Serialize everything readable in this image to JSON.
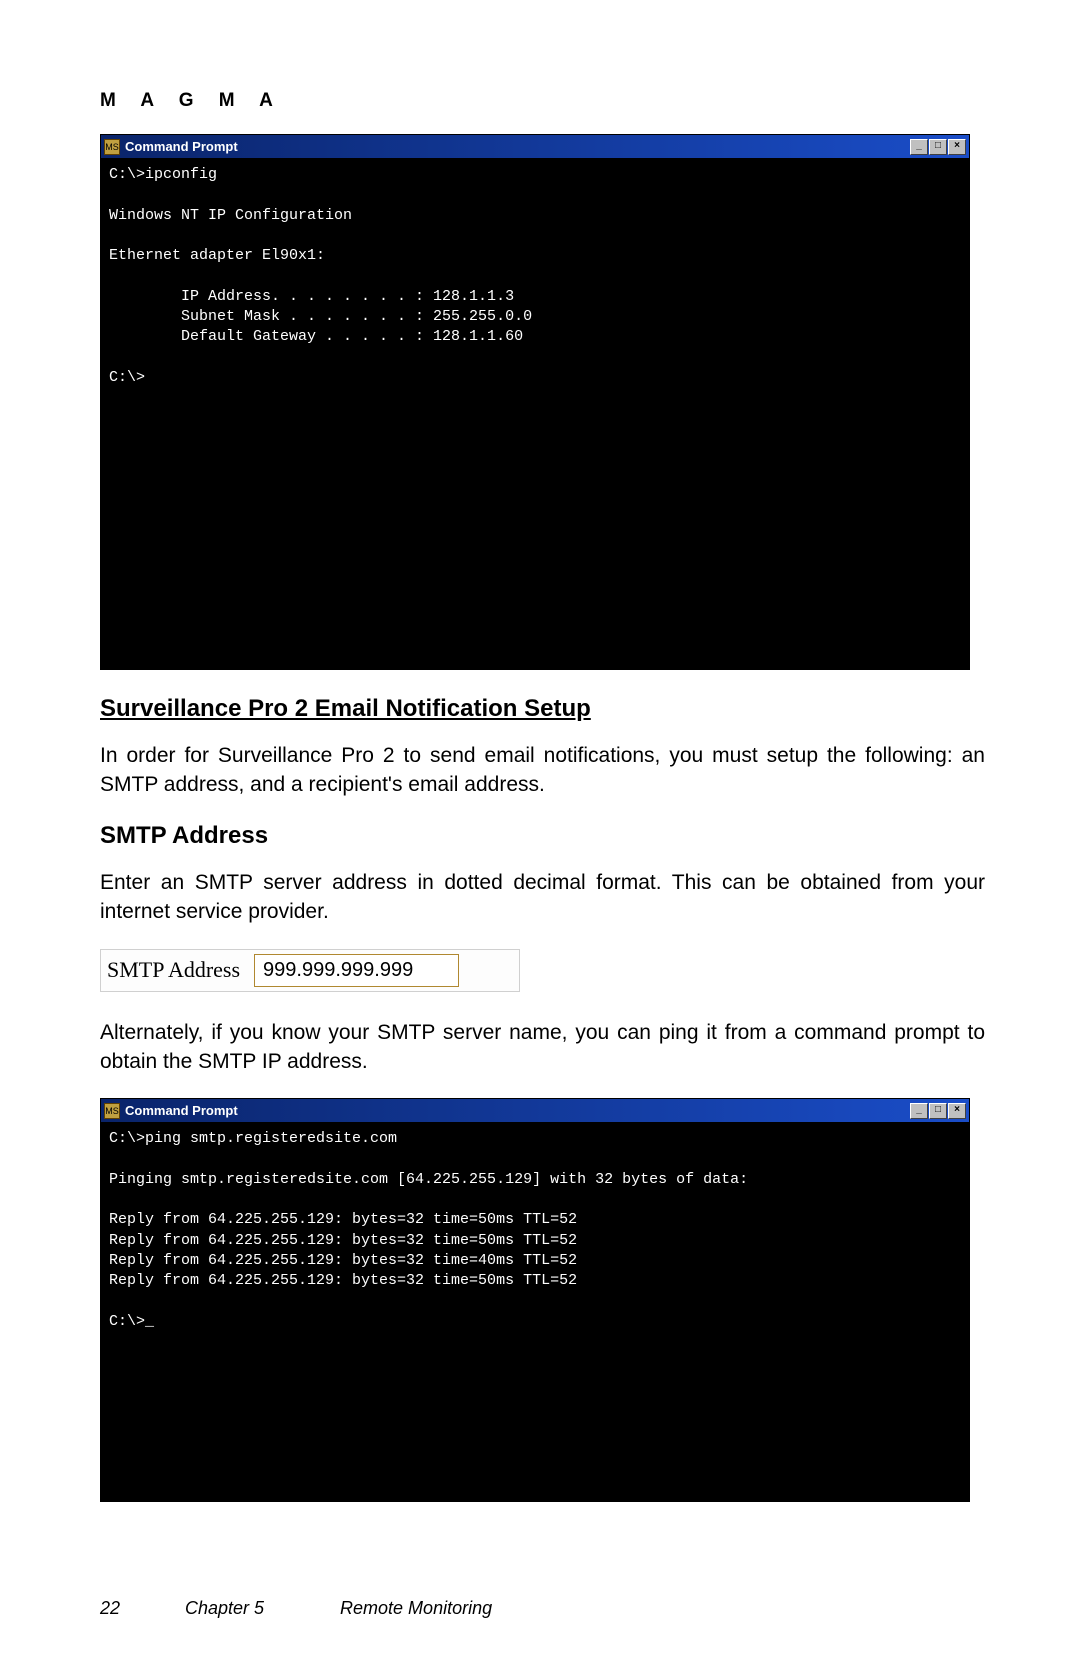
{
  "brand": "M A G M A",
  "cmd1": {
    "title": "Command Prompt",
    "content": "C:\\>ipconfig\n\nWindows NT IP Configuration\n\nEthernet adapter El90x1:\n\n        IP Address. . . . . . . . : 128.1.1.3\n        Subnet Mask . . . . . . . : 255.255.0.0\n        Default Gateway . . . . . : 128.1.1.60\n\nC:\\>"
  },
  "heading1": "Surveillance Pro 2 Email Notification Setup",
  "para1": "In order for Surveillance Pro 2 to send email notifications, you must setup the following: an SMTP address, and a recipient's email address.",
  "heading2": "SMTP Address",
  "para2": "Enter an SMTP server address in dotted decimal format. This can be obtained from your internet service provider.",
  "smtp": {
    "label": "SMTP Address",
    "value": "999.999.999.999"
  },
  "para3": "Alternately, if you know your SMTP server name, you can ping it from a command prompt to obtain the SMTP IP address.",
  "cmd2": {
    "title": "Command Prompt",
    "content": "C:\\>ping smtp.registeredsite.com\n\nPinging smtp.registeredsite.com [64.225.255.129] with 32 bytes of data:\n\nReply from 64.225.255.129: bytes=32 time=50ms TTL=52\nReply from 64.225.255.129: bytes=32 time=50ms TTL=52\nReply from 64.225.255.129: bytes=32 time=40ms TTL=52\nReply from 64.225.255.129: bytes=32 time=50ms TTL=52\n\nC:\\>_"
  },
  "footer": {
    "page": "22",
    "chapter": "Chapter 5",
    "title": "Remote Monitoring"
  },
  "winbuttons": {
    "min": "_",
    "max": "□",
    "close": "×"
  }
}
